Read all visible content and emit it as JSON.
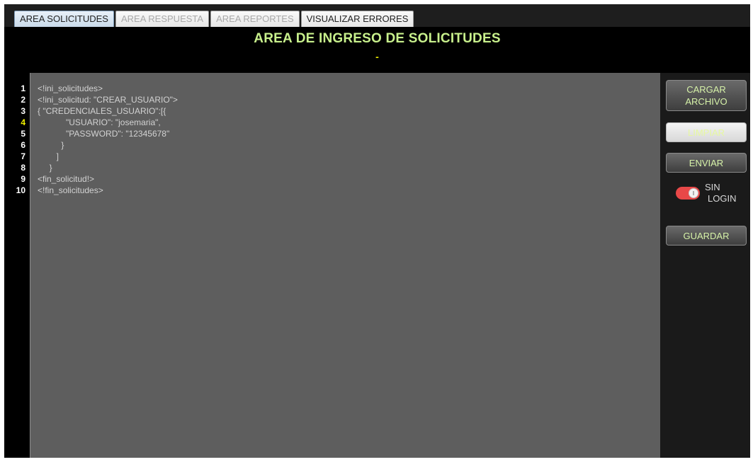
{
  "tabs": [
    {
      "label": "AREA SOLICITUDES"
    },
    {
      "label": "AREA RESPUESTA"
    },
    {
      "label": "AREA REPORTES"
    },
    {
      "label": "VISUALIZAR ERRORES"
    }
  ],
  "header": {
    "title": "AREA DE INGRESO DE SOLICITUDES",
    "status": "-"
  },
  "editor": {
    "current_line": 4,
    "line_numbers": [
      "1",
      "2",
      "3",
      "4",
      "5",
      "6",
      "7",
      "8",
      "9",
      "10"
    ],
    "lines": [
      "<!ini_solicitudes>",
      "<!ini_solicitud: \"CREAR_USUARIO\">",
      "{ \"CREDENCIALES_USUARIO\":[{",
      "            \"USUARIO\": \"josemaria\",",
      "            \"PASSWORD\": \"12345678\"",
      "          }",
      "        ]",
      "     }",
      "<fin_solicitud!>",
      "<!fin_solicitudes>"
    ]
  },
  "sidebar": {
    "load_button": [
      "CARGAR",
      "ARCHIVO"
    ],
    "clear_button": "LIMPIAR",
    "send_button": "ENVIAR",
    "toggle": {
      "label": [
        "SIN",
        "LOGIN"
      ],
      "on": true
    },
    "save_button": "GUARDAR"
  },
  "colors": {
    "title": "#c8f08c",
    "editor_bg": "#5e5e5e",
    "toggle_on": "#e84848",
    "current_line": "#f0f000"
  }
}
